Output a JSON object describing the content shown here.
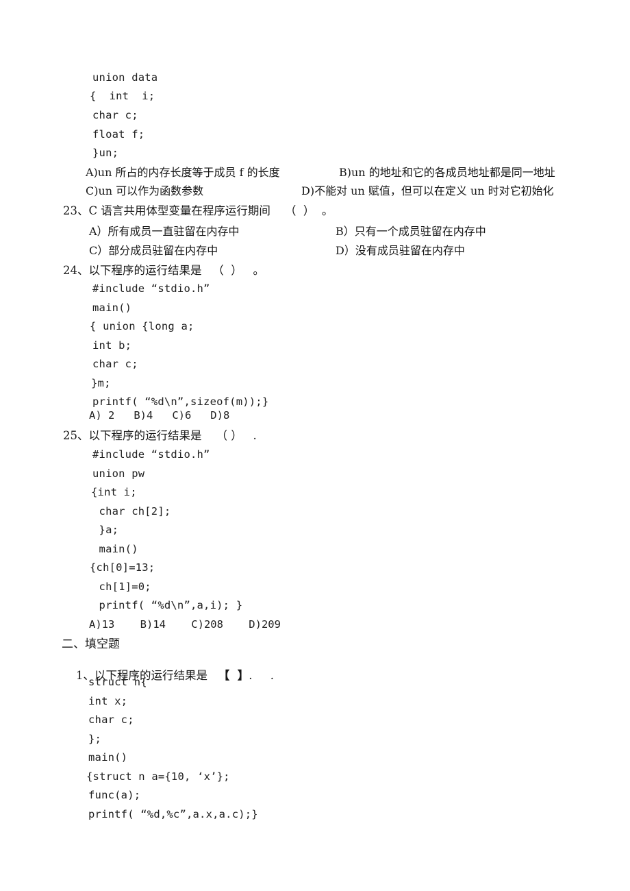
{
  "document": {
    "page_background": "#ffffff",
    "text_color": "#171717"
  },
  "blocks": {
    "q22_code": [
      "union data",
      "{  int  i;",
      "char c;",
      "float f;",
      "}un;"
    ],
    "q22_options": {
      "a": "A)un 所占的内存长度等于成员 f 的长度",
      "b": "B)un 的地址和它的各成员地址都是同一地址",
      "c": "C)un 可以作为函数参数",
      "d": "D)不能对 un 赋值，但可以在定义 un 时对它初始化"
    },
    "q23": {
      "stem": "23、C 语言共用体型变量在程序运行期间    （  ）  。",
      "a": "A）所有成员一直驻留在内存中",
      "b": "B）只有一个成员驻留在内存中",
      "c": "C）部分成员驻留在内存中",
      "d": "D）没有成员驻留在内存中"
    },
    "q24": {
      "stem": "24、以下程序的运行结果是   （  ）   。",
      "code": [
        "#include “stdio.h”",
        "main()",
        "{ union {long a;",
        "int b;",
        "char c;",
        "}m;",
        "printf( “%d\\n”,sizeof(m));}"
      ],
      "answers": "A) 2   B)4   C)6   D)8"
    },
    "q25": {
      "stem": "25、以下程序的运行结果是    （ ）   .",
      "code": [
        "#include “stdio.h”",
        "union pw",
        "{int i;",
        " char ch[2];",
        " }a;",
        " main()",
        "{ch[0]=13;",
        " ch[1]=0;",
        " printf( “%d\\n”,a,i); }"
      ],
      "answers": "A)13    B)14    C)208    D)209"
    },
    "section2": {
      "heading": "二、填空题",
      "q1_stem_pre": "1、以下程序的运行结果是",
      "q1_blank": "【  】",
      "q1_stem_post": ".",
      "q1_trailing_dot": ".",
      "code": [
        "struct n{",
        "int x;",
        "char c;",
        "};",
        "main()",
        "{struct n a={10, ‘x’};",
        "func(a);",
        "printf( “%d,%c”,a.x,a.c);}"
      ]
    }
  }
}
